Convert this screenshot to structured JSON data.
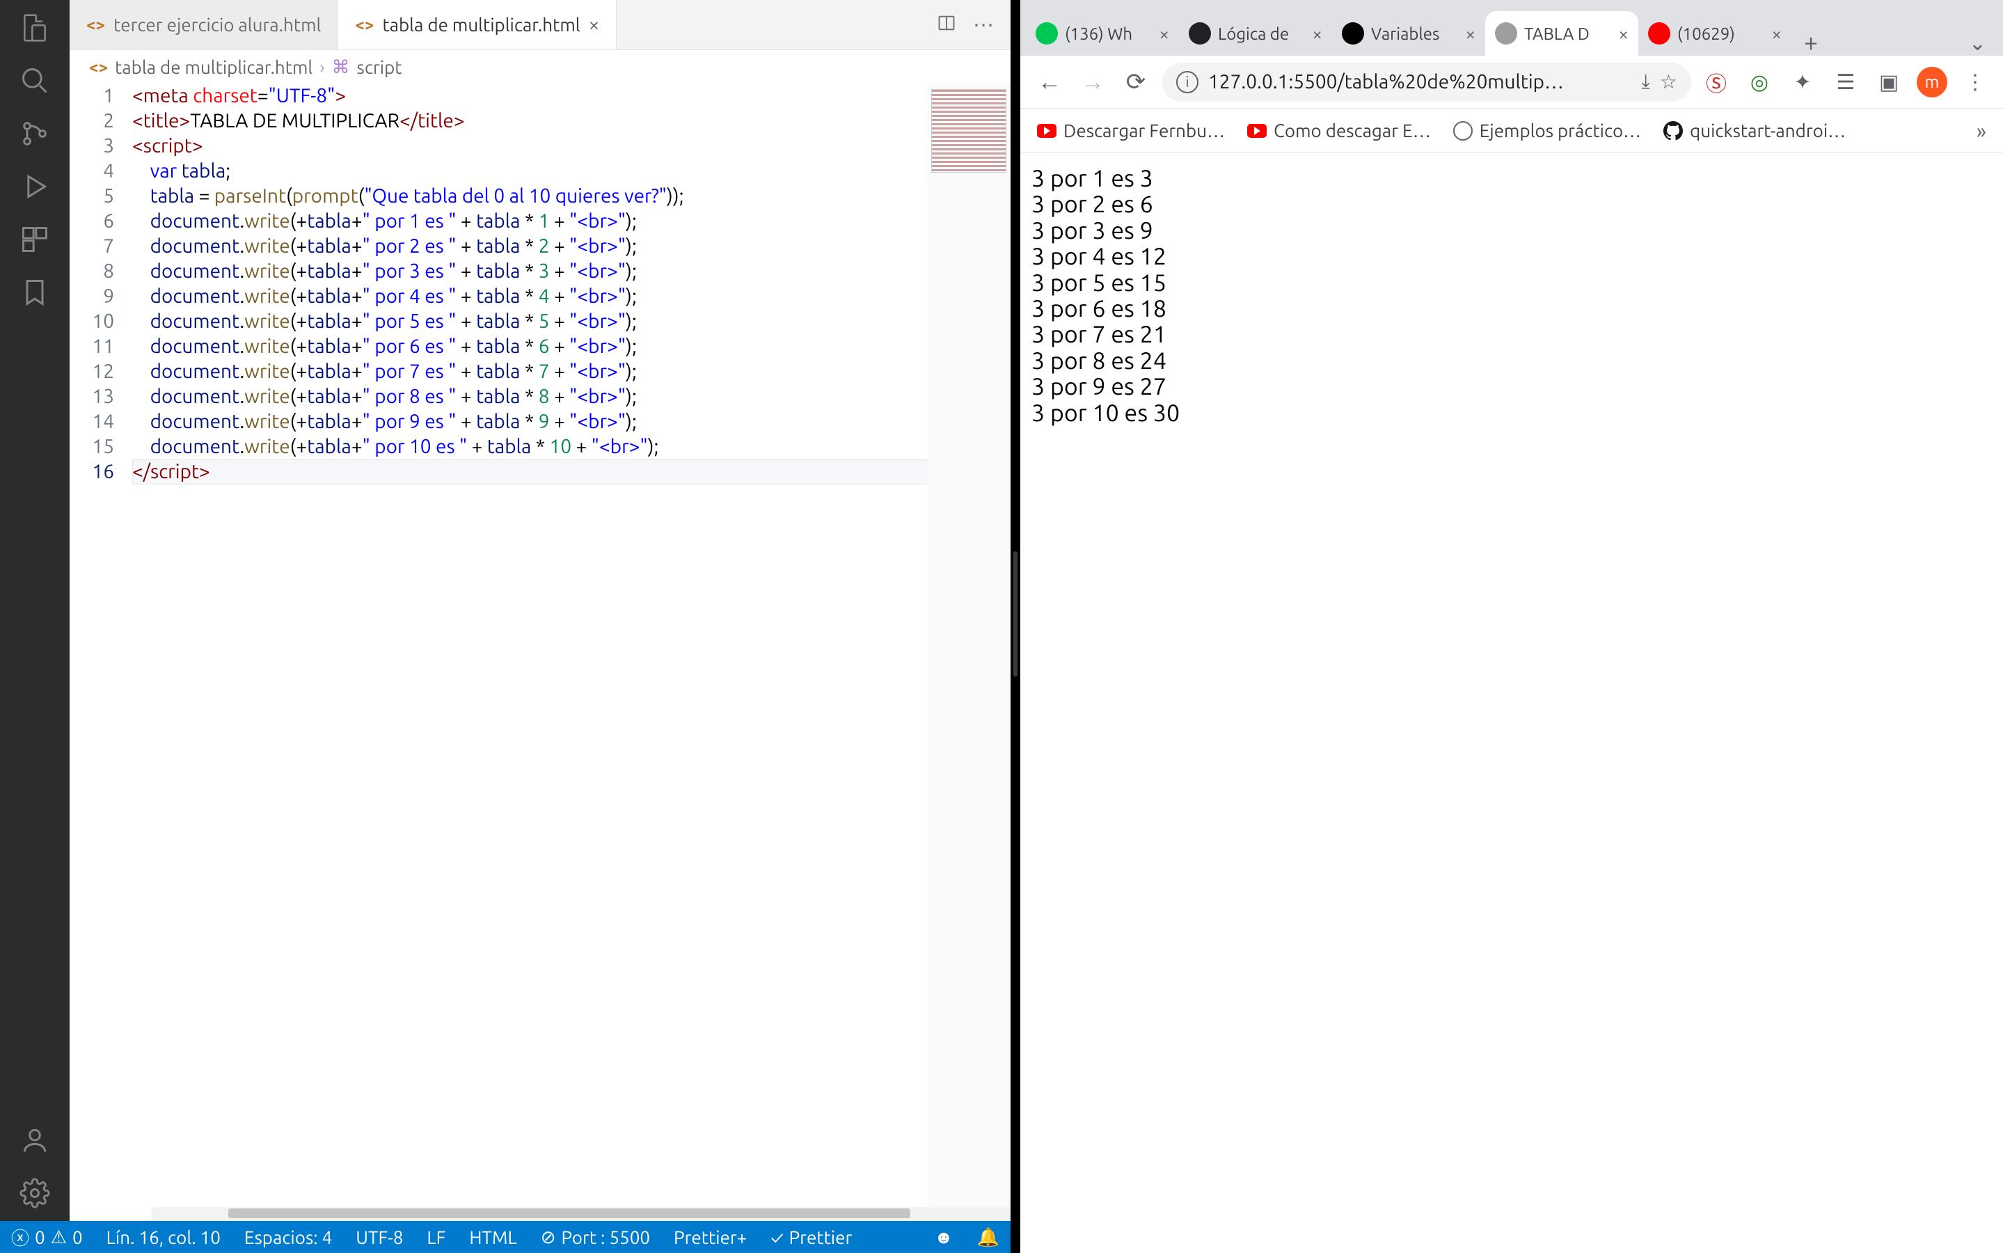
{
  "vscode": {
    "tabs": [
      {
        "label": "tercer ejercicio alura.html",
        "active": false
      },
      {
        "label": "tabla de multiplicar.html",
        "active": true
      }
    ],
    "breadcrumbs": {
      "file": "tabla de multiplicar.html",
      "symbol": "script"
    },
    "code": {
      "lines": [
        {
          "n": 1,
          "html": "<span class='t-tag'>&lt;meta</span> <span class='t-attr'>charset</span>=<span class='t-str'>\"UTF-8\"</span><span class='t-tag'>&gt;</span>"
        },
        {
          "n": 2,
          "html": "<span class='t-tag'>&lt;title&gt;</span><span class='t-txt'>TABLA DE MULTIPLICAR</span><span class='t-tag'>&lt;/title&gt;</span>"
        },
        {
          "n": 3,
          "html": "<span class='t-tag'>&lt;script&gt;</span>"
        },
        {
          "n": 4,
          "html": "    <span class='t-kw'>var</span> <span class='t-var'>tabla</span>;"
        },
        {
          "n": 5,
          "html": "    <span class='t-var'>tabla</span> = <span class='t-fn'>parseInt</span>(<span class='t-fn'>prompt</span>(<span class='t-str'>\"Que tabla del 0 al 10 quieres ver?\"</span>));"
        },
        {
          "n": 6,
          "html": "    <span class='t-var'>document</span>.<span class='t-fn'>write</span>(+<span class='t-var'>tabla</span>+<span class='t-str'>\" por 1 es \"</span> + <span class='t-var'>tabla</span> <span class='t-op'>*</span> <span class='t-num'>1</span> + <span class='t-str'>\"&lt;br&gt;\"</span>);"
        },
        {
          "n": 7,
          "html": "    <span class='t-var'>document</span>.<span class='t-fn'>write</span>(+<span class='t-var'>tabla</span>+<span class='t-str'>\" por 2 es \"</span> + <span class='t-var'>tabla</span> <span class='t-op'>*</span> <span class='t-num'>2</span> + <span class='t-str'>\"&lt;br&gt;\"</span>);"
        },
        {
          "n": 8,
          "html": "    <span class='t-var'>document</span>.<span class='t-fn'>write</span>(+<span class='t-var'>tabla</span>+<span class='t-str'>\" por 3 es \"</span> + <span class='t-var'>tabla</span> <span class='t-op'>*</span> <span class='t-num'>3</span> + <span class='t-str'>\"&lt;br&gt;\"</span>);"
        },
        {
          "n": 9,
          "html": "    <span class='t-var'>document</span>.<span class='t-fn'>write</span>(+<span class='t-var'>tabla</span>+<span class='t-str'>\" por 4 es \"</span> + <span class='t-var'>tabla</span> <span class='t-op'>*</span> <span class='t-num'>4</span> + <span class='t-str'>\"&lt;br&gt;\"</span>);"
        },
        {
          "n": 10,
          "html": "    <span class='t-var'>document</span>.<span class='t-fn'>write</span>(+<span class='t-var'>tabla</span>+<span class='t-str'>\" por 5 es \"</span> + <span class='t-var'>tabla</span> <span class='t-op'>*</span> <span class='t-num'>5</span> + <span class='t-str'>\"&lt;br&gt;\"</span>);"
        },
        {
          "n": 11,
          "html": "    <span class='t-var'>document</span>.<span class='t-fn'>write</span>(+<span class='t-var'>tabla</span>+<span class='t-str'>\" por 6 es \"</span> + <span class='t-var'>tabla</span> <span class='t-op'>*</span> <span class='t-num'>6</span> + <span class='t-str'>\"&lt;br&gt;\"</span>);"
        },
        {
          "n": 12,
          "html": "    <span class='t-var'>document</span>.<span class='t-fn'>write</span>(+<span class='t-var'>tabla</span>+<span class='t-str'>\" por 7 es \"</span> + <span class='t-var'>tabla</span> <span class='t-op'>*</span> <span class='t-num'>7</span> + <span class='t-str'>\"&lt;br&gt;\"</span>);"
        },
        {
          "n": 13,
          "html": "    <span class='t-var'>document</span>.<span class='t-fn'>write</span>(+<span class='t-var'>tabla</span>+<span class='t-str'>\" por 8 es \"</span> + <span class='t-var'>tabla</span> <span class='t-op'>*</span> <span class='t-num'>8</span> + <span class='t-str'>\"&lt;br&gt;\"</span>);"
        },
        {
          "n": 14,
          "html": "    <span class='t-var'>document</span>.<span class='t-fn'>write</span>(+<span class='t-var'>tabla</span>+<span class='t-str'>\" por 9 es \"</span> + <span class='t-var'>tabla</span> <span class='t-op'>*</span> <span class='t-num'>9</span> + <span class='t-str'>\"&lt;br&gt;\"</span>);"
        },
        {
          "n": 15,
          "html": "    <span class='t-var'>document</span>.<span class='t-fn'>write</span>(+<span class='t-var'>tabla</span>+<span class='t-str'>\" por 10 es \"</span> + <span class='t-var'>tabla</span> <span class='t-op'>*</span> <span class='t-num'>10</span> + <span class='t-str'>\"&lt;br&gt;\"</span>);"
        },
        {
          "n": 16,
          "html": "<span class='t-tag'>&lt;/script&gt;</span>",
          "active": true
        }
      ]
    },
    "status": {
      "errors": "0",
      "warnings": "0",
      "cursor": "Lín. 16, col. 10",
      "spaces": "Espacios: 4",
      "encoding": "UTF-8",
      "eol": "LF",
      "language": "HTML",
      "port": "Port : 5500",
      "prettierplus": "Prettier+",
      "prettier": "Prettier"
    }
  },
  "chrome": {
    "tabs": [
      {
        "title": "(136) Wh",
        "fav": "#00c853"
      },
      {
        "title": "Lógica de",
        "fav": "#202124"
      },
      {
        "title": "Variables",
        "fav": "#000000"
      },
      {
        "title": "TABLA D",
        "fav": "#9e9e9e",
        "active": true
      },
      {
        "title": "(10629)",
        "fav": "#ff0000"
      }
    ],
    "url": "127.0.0.1:5500/tabla%20de%20multip…",
    "avatar": "m",
    "bookmarks": [
      {
        "label": "Descargar Fernbu…",
        "icon": "yt"
      },
      {
        "label": "Como descagar E…",
        "icon": "yt"
      },
      {
        "label": "Ejemplos práctico…",
        "icon": "globe"
      },
      {
        "label": "quickstart-androi…",
        "icon": "gh"
      }
    ],
    "page_lines": [
      "3 por 1 es 3",
      "3 por 2 es 6",
      "3 por 3 es 9",
      "3 por 4 es 12",
      "3 por 5 es 15",
      "3 por 6 es 18",
      "3 por 7 es 21",
      "3 por 8 es 24",
      "3 por 9 es 27",
      "3 por 10 es 30"
    ]
  }
}
